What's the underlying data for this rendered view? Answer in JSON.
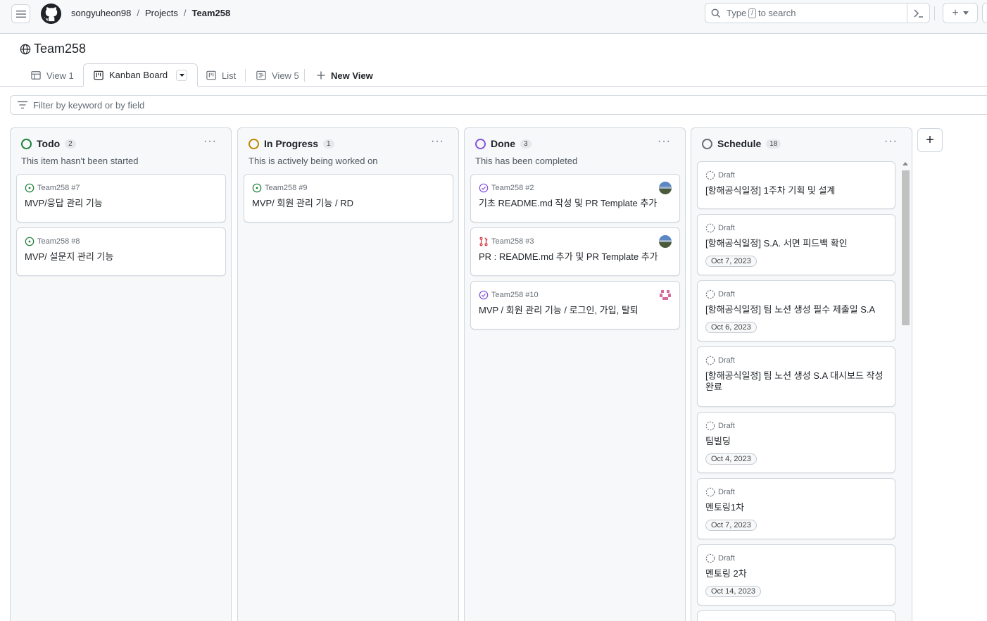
{
  "breadcrumb": {
    "owner": "songyuheon98",
    "section": "Projects",
    "project": "Team258"
  },
  "search": {
    "placeholder_pre": "Type",
    "key": "/",
    "placeholder_post": "to search"
  },
  "project": {
    "title": "Team258"
  },
  "views": [
    {
      "label": "View 1"
    },
    {
      "label": "Kanban Board"
    },
    {
      "label": "List"
    },
    {
      "label": "View 5"
    },
    {
      "label": "New View"
    }
  ],
  "filter": {
    "placeholder": "Filter by keyword or by field"
  },
  "columns": [
    {
      "name": "Todo",
      "count": "2",
      "color": "#1a7f37",
      "description": "This item hasn't been started",
      "cards": [
        {
          "ref": "Team258 #7",
          "title": "MVP/응답 관리 기능",
          "status": "open"
        },
        {
          "ref": "Team258 #8",
          "title": "MVP/ 설문지 관리 기능",
          "status": "open"
        }
      ]
    },
    {
      "name": "In Progress",
      "count": "1",
      "color": "#bf8700",
      "description": "This is actively being worked on",
      "cards": [
        {
          "ref": "Team258 #9",
          "title": "MVP/ 회원 관리 기능 / RD",
          "status": "open"
        }
      ]
    },
    {
      "name": "Done",
      "count": "3",
      "color": "#8250df",
      "description": "This has been completed",
      "cards": [
        {
          "ref": "Team258 #2",
          "title": "기초 README.md 작성 및 PR Template 추가",
          "status": "closed"
        },
        {
          "ref": "Team258 #3",
          "title": "PR : README.md 추가 및 PR Template 추가",
          "status": "pr"
        },
        {
          "ref": "Team258 #10",
          "title": "MVP / 회원 관리 기능 / 로그인, 가입, 탈퇴",
          "status": "closed"
        }
      ]
    },
    {
      "name": "Schedule",
      "count": "18",
      "color": "#656d76",
      "description": "",
      "cards": [
        {
          "ref": "Draft",
          "title": "[항해공식일정] 1주차 기획 및 설계",
          "date": ""
        },
        {
          "ref": "Draft",
          "title": "[항해공식일정] S.A. 서면 피드백 확인",
          "date": "Oct 7, 2023"
        },
        {
          "ref": "Draft",
          "title": "[항해공식일정] 팀 노션 생성 필수 제출일 S.A",
          "date": "Oct 6, 2023"
        },
        {
          "ref": "Draft",
          "title": "[항해공식일정] 팀 노션 생성 S.A 대시보드 작성 완료",
          "date": ""
        },
        {
          "ref": "Draft",
          "title": "팀빌딩",
          "date": "Oct 4, 2023"
        },
        {
          "ref": "Draft",
          "title": "멘토링1차",
          "date": "Oct 7, 2023"
        },
        {
          "ref": "Draft",
          "title": "멘토링 2차",
          "date": "Oct 14, 2023"
        }
      ]
    }
  ]
}
